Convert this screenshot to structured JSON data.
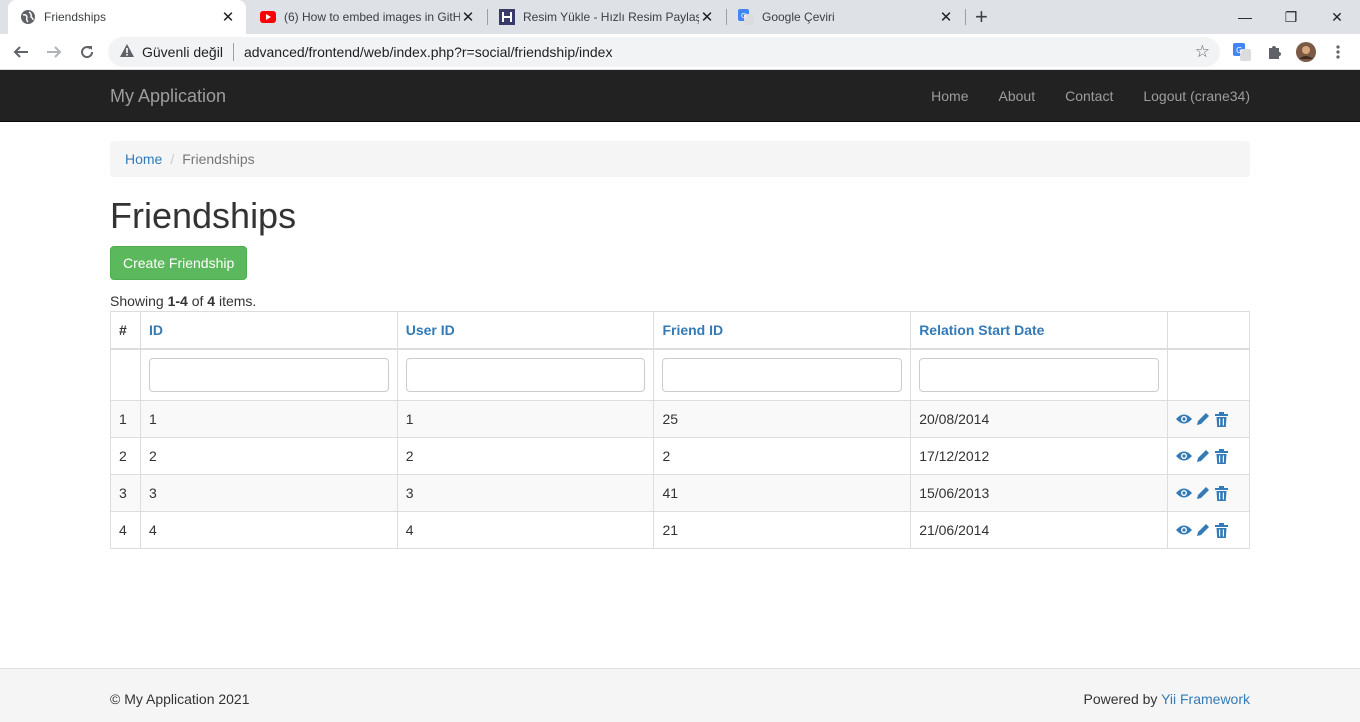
{
  "browser": {
    "tabs": [
      {
        "title": "Friendships",
        "active": true
      },
      {
        "title": "(6) How to embed images in GitH",
        "active": false
      },
      {
        "title": "Resim Yükle - Hızlı Resim Paylaş",
        "active": false
      },
      {
        "title": "Google Çeviri",
        "active": false
      }
    ],
    "new_tab": "+",
    "close_glyph": "✕",
    "window_controls": {
      "minimize": "—",
      "maximize": "❐",
      "close": "✕"
    },
    "security_label": "Güvenli değil",
    "url": "advanced/frontend/web/index.php?r=social/friendship/index"
  },
  "app": {
    "brand": "My Application",
    "nav": [
      "Home",
      "About",
      "Contact",
      "Logout (crane34)"
    ]
  },
  "breadcrumb": {
    "home": "Home",
    "current": "Friendships"
  },
  "page": {
    "title": "Friendships",
    "create_button": "Create Friendship",
    "summary": {
      "prefix": "Showing ",
      "range": "1-4",
      "of": " of ",
      "total": "4",
      "suffix": " items."
    }
  },
  "table": {
    "columns": [
      "#",
      "ID",
      "User ID",
      "Friend ID",
      "Relation Start Date"
    ],
    "rows": [
      {
        "n": "1",
        "id": "1",
        "user_id": "1",
        "friend_id": "25",
        "date": "20/08/2014"
      },
      {
        "n": "2",
        "id": "2",
        "user_id": "2",
        "friend_id": "2",
        "date": "17/12/2012"
      },
      {
        "n": "3",
        "id": "3",
        "user_id": "3",
        "friend_id": "41",
        "date": "15/06/2013"
      },
      {
        "n": "4",
        "id": "4",
        "user_id": "4",
        "friend_id": "21",
        "date": "21/06/2014"
      }
    ],
    "action_icons": [
      "eye-icon",
      "pencil-icon",
      "trash-icon"
    ],
    "action_color": "#337ab7"
  },
  "footer": {
    "copyright": "© My Application 2021",
    "powered_prefix": "Powered by ",
    "powered_link": "Yii Framework"
  }
}
